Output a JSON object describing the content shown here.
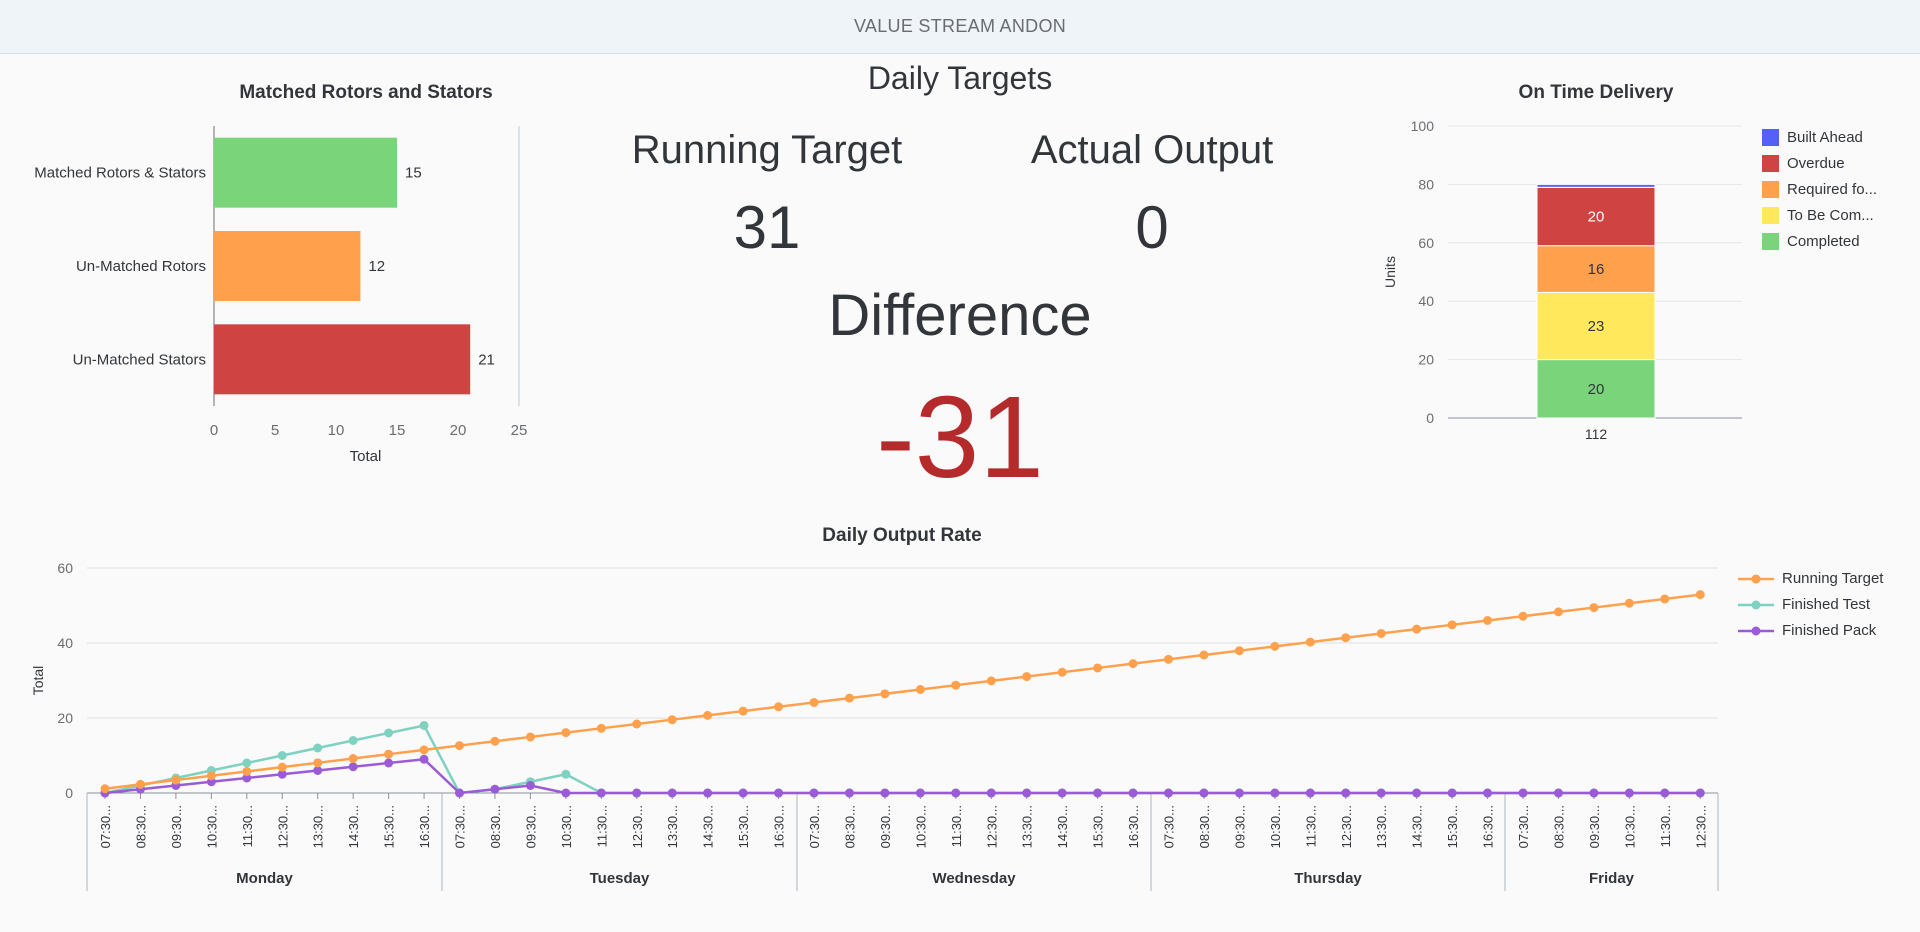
{
  "header": {
    "title": "VALUE STREAM ANDON"
  },
  "daily_targets": {
    "title": "Daily Targets",
    "running_target_label": "Running Target",
    "running_target_value": "31",
    "actual_output_label": "Actual Output",
    "actual_output_value": "0",
    "difference_label": "Difference",
    "difference_value": "-31"
  },
  "colors": {
    "green": "#79d47a",
    "orange": "#ffa04d",
    "red": "#d04343",
    "yellow": "#ffe85c",
    "blue": "#5561f5",
    "teal": "#7fd1c2",
    "purple": "#9b5bd6",
    "diff_red": "#b52a2a"
  },
  "chart_data": [
    {
      "id": "matched",
      "type": "bar",
      "orientation": "horizontal",
      "title": "Matched Rotors and Stators",
      "categories": [
        "Matched Rotors & Stators",
        "Un-Matched Rotors",
        "Un-Matched Stators"
      ],
      "values": [
        15,
        12,
        21
      ],
      "xlabel": "Total",
      "xlim": [
        0,
        25
      ],
      "xticks": [
        "0",
        "5",
        "10",
        "15",
        "20",
        "25"
      ],
      "grid": false
    },
    {
      "id": "otd",
      "type": "bar",
      "stacked": true,
      "title": "On Time Delivery",
      "categories": [
        "112"
      ],
      "ylabel": "Units",
      "ylim": [
        0,
        100
      ],
      "yticks": [
        "0",
        "20",
        "40",
        "60",
        "80",
        "100"
      ],
      "series": [
        {
          "name": "Completed",
          "values": [
            20
          ],
          "label": "20"
        },
        {
          "name": "To Be Com...",
          "values": [
            23
          ],
          "label": "23"
        },
        {
          "name": "Required fo...",
          "values": [
            16
          ],
          "label": "16"
        },
        {
          "name": "Overdue",
          "values": [
            20
          ],
          "label": "20"
        },
        {
          "name": "Built Ahead",
          "values": [
            1
          ],
          "label": ""
        }
      ],
      "legend_order": [
        "Built Ahead",
        "Overdue",
        "Required fo...",
        "To Be Com...",
        "Completed"
      ],
      "legend_position": "right",
      "grid": true
    },
    {
      "id": "output",
      "type": "line",
      "title": "Daily Output Rate",
      "ylabel": "Total",
      "ylim": [
        0,
        60
      ],
      "yticks": [
        "0",
        "20",
        "40",
        "60"
      ],
      "days": [
        "Monday",
        "Tuesday",
        "Wednesday",
        "Thursday",
        "Friday"
      ],
      "times": [
        "07:30...",
        "08:30...",
        "09:30...",
        "10:30...",
        "11:30...",
        "12:30...",
        "13:30...",
        "14:30...",
        "15:30...",
        "16:30..."
      ],
      "friday_times": [
        "07:30...",
        "08:30...",
        "09:30...",
        "10:30...",
        "11:30...",
        "12:30..."
      ],
      "series": [
        {
          "name": "Running Target",
          "values": [
            1.15,
            2.3,
            3.45,
            4.6,
            5.75,
            6.9,
            8.05,
            9.2,
            10.35,
            11.5,
            12.65,
            13.8,
            14.95,
            16.1,
            17.25,
            18.4,
            19.55,
            20.7,
            21.85,
            23,
            24.15,
            25.3,
            26.45,
            27.6,
            28.75,
            29.9,
            31.05,
            32.2,
            33.35,
            34.5,
            35.65,
            36.8,
            37.95,
            39.1,
            40.25,
            41.4,
            42.55,
            43.7,
            44.85,
            46,
            47.15,
            48.3,
            49.45,
            50.6,
            51.75,
            52.9
          ]
        },
        {
          "name": "Finished Test",
          "values": [
            0,
            2,
            4,
            6,
            8,
            10,
            12,
            14,
            16,
            18,
            0,
            1,
            3,
            5,
            0,
            0,
            0,
            0,
            0,
            0,
            0,
            0,
            0,
            0,
            0,
            0,
            0,
            0,
            0,
            0,
            0,
            0,
            0,
            0,
            0,
            0,
            0,
            0,
            0,
            0,
            0,
            0,
            0,
            0,
            0,
            0
          ]
        },
        {
          "name": "Finished Pack",
          "values": [
            0,
            1,
            2,
            3,
            4,
            5,
            6,
            7,
            8,
            9,
            0,
            1,
            2,
            0,
            0,
            0,
            0,
            0,
            0,
            0,
            0,
            0,
            0,
            0,
            0,
            0,
            0,
            0,
            0,
            0,
            0,
            0,
            0,
            0,
            0,
            0,
            0,
            0,
            0,
            0,
            0,
            0,
            0,
            0,
            0,
            0
          ]
        }
      ],
      "legend_position": "right",
      "grid": true
    }
  ]
}
